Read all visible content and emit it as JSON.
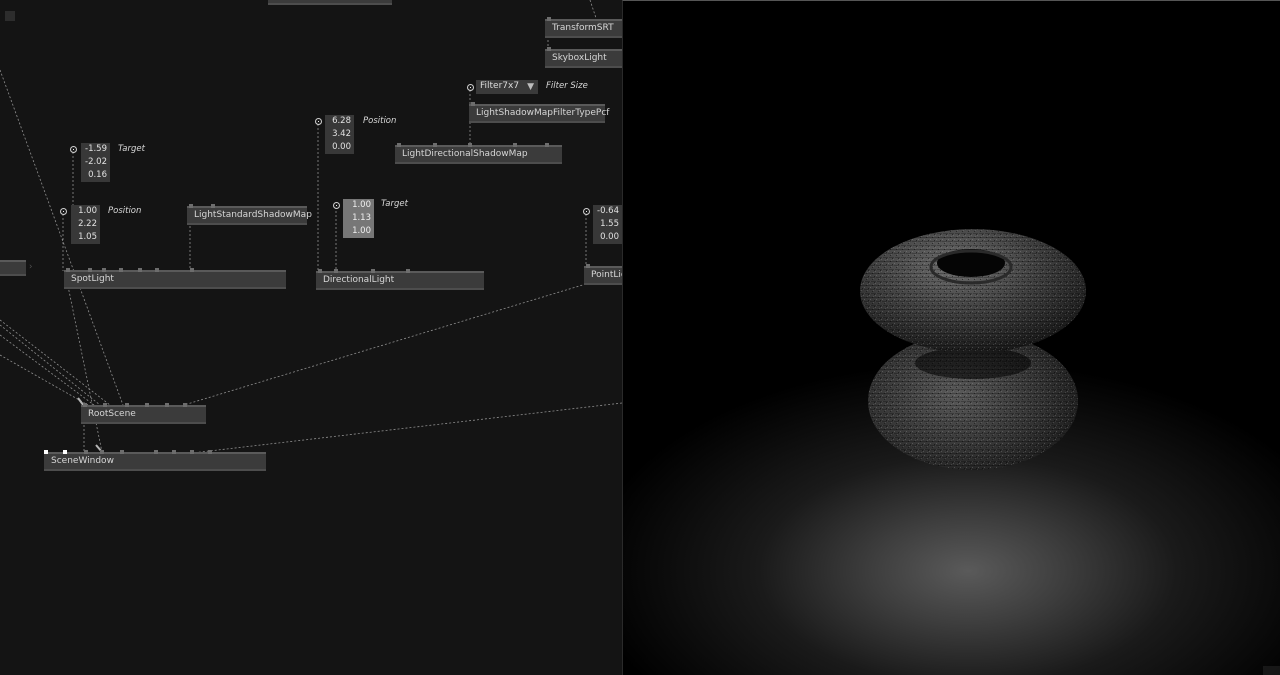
{
  "graph": {
    "nodes": {
      "transform_srt": "TransformSRT",
      "skybox_light": "SkyboxLight",
      "shadow_filter_pcf": "LightShadowMapFilterTypePcf",
      "directional_shadow_map": "LightDirectionalShadowMap",
      "standard_shadow_map": "LightStandardShadowMap",
      "spot_light": "SpotLight",
      "directional_light": "DirectionalLight",
      "point_light": "PointLig",
      "root_scene": "RootScene",
      "scene_window": "SceneWindow"
    },
    "filter": {
      "value": "Filter7x7",
      "label": "Filter Size"
    },
    "spot_target": {
      "label": "Target",
      "values": [
        "-1.59",
        "-2.02",
        "0.16"
      ]
    },
    "spot_position": {
      "label": "Position",
      "values": [
        "1.00",
        "2.22",
        "1.05"
      ]
    },
    "dir_position": {
      "label": "Position",
      "values": [
        "6.28",
        "3.42",
        "0.00"
      ]
    },
    "dir_target": {
      "label": "Target",
      "values": [
        "1.00",
        "1.13",
        "1.00"
      ]
    },
    "point_position": {
      "values": [
        "-0.64",
        "1.55",
        "0.00"
      ]
    },
    "collapse_arrow": "›"
  },
  "colors": {
    "graph_bg": "#141414",
    "node_bg": "#3b3b3b",
    "wire": "#9a9a9a",
    "viewport_bg": "#000000"
  }
}
